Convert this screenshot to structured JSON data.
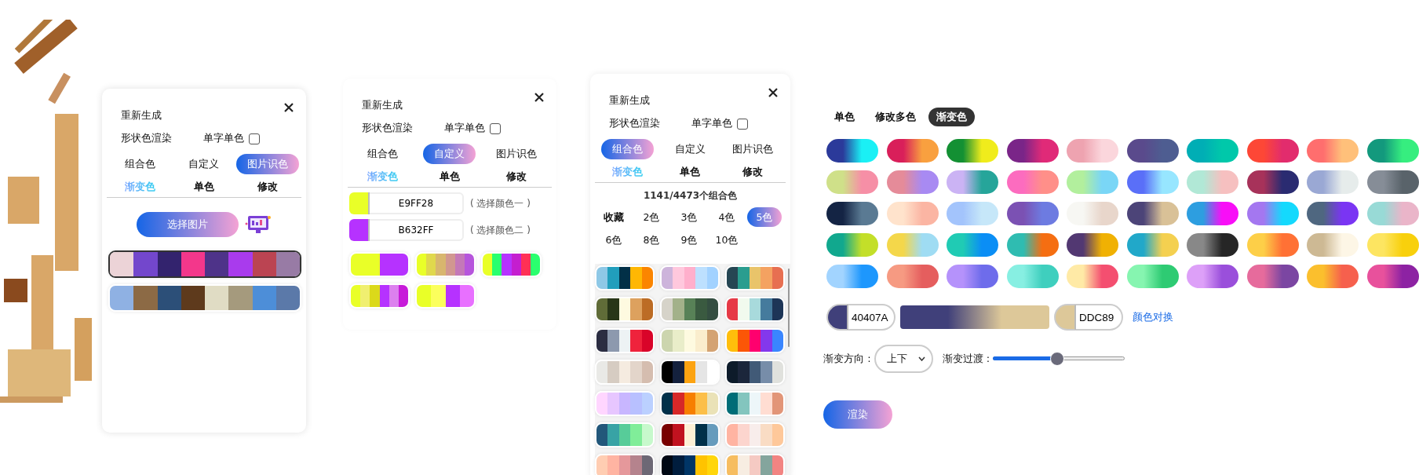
{
  "panels": [
    {
      "kind": "image",
      "title": "重新生成",
      "render_option": "形状色渲染",
      "single_color": {
        "label": "单字单色",
        "checked": false
      },
      "modes": [
        {
          "label": "组合色",
          "selected": false
        },
        {
          "label": "自定义",
          "selected": false
        },
        {
          "label": "图片识色",
          "selected": true
        }
      ],
      "sub_modes": [
        {
          "label": "渐变色",
          "accent": true
        },
        {
          "label": "单色",
          "accent": false
        },
        {
          "label": "修改",
          "accent": false
        }
      ],
      "pick_button": "选择图片",
      "palettes": [
        {
          "selected": true,
          "swatches": [
            {
              "color": "#ecd3d7"
            },
            {
              "color": "#7347cc"
            },
            {
              "color": "#33236e"
            },
            {
              "color": "#f3378b"
            },
            {
              "color": "#4e3389"
            },
            {
              "color": "#a93bed"
            },
            {
              "color": "#bb4452"
            },
            {
              "color": "#987ba5"
            }
          ]
        },
        {
          "selected": false,
          "swatches": [
            {
              "color": "#8fb1e3"
            },
            {
              "color": "#8c6a45"
            },
            {
              "color": "#2c4f78"
            },
            {
              "color": "#5e3a1c"
            },
            {
              "color": "#e0dcc4"
            },
            {
              "color": "#a59a7d"
            },
            {
              "color": "#4d8ed8"
            },
            {
              "color": "#5b79a9"
            }
          ]
        }
      ]
    },
    {
      "kind": "custom",
      "title": "重新生成",
      "render_option": "形状色渲染",
      "single_color": {
        "label": "单字单色",
        "checked": false
      },
      "modes": [
        {
          "label": "组合色",
          "selected": false
        },
        {
          "label": "自定义",
          "selected": true
        },
        {
          "label": "图片识色",
          "selected": false
        }
      ],
      "sub_modes": [
        {
          "label": "渐变色",
          "accent": true
        },
        {
          "label": "单色",
          "accent": false
        },
        {
          "label": "修改",
          "accent": false
        }
      ],
      "color_inputs": [
        {
          "value": "E9FF28",
          "color": "#e9ff28",
          "hint": "( 选择颜色一 )"
        },
        {
          "value": "B632FF",
          "color": "#b632ff",
          "hint": "( 选择颜色二 )"
        }
      ],
      "palettes": [
        {
          "selected": false,
          "swatches": [
            {
              "color": "#e9ff28"
            },
            {
              "color": "#b632ff"
            }
          ]
        },
        {
          "selected": false,
          "swatches": [
            {
              "color": "#e9ff28"
            },
            {
              "color": "#e0d84c"
            },
            {
              "color": "#d8b66e"
            },
            {
              "color": "#d19790"
            },
            {
              "color": "#c478b8"
            },
            {
              "color": "#b655dc"
            }
          ]
        },
        {
          "selected": false,
          "swatches": [
            {
              "color": "#e9ff28"
            },
            {
              "color": "#2aff6e"
            },
            {
              "color": "#b632ff"
            },
            {
              "color": "#c41ecf"
            },
            {
              "color": "#ff3055"
            },
            {
              "color": "#2aff6e"
            }
          ]
        },
        {
          "selected": false,
          "swatches": [
            {
              "color": "#e9ff28"
            },
            {
              "color": "#f0ef70"
            },
            {
              "color": "#dbd91a"
            },
            {
              "color": "#b632ff"
            },
            {
              "color": "#dc80ee"
            },
            {
              "color": "#c71ad9"
            }
          ]
        },
        {
          "selected": false,
          "swatches": [
            {
              "color": "#e9ff28"
            },
            {
              "color": "#fbff5c"
            },
            {
              "color": "#b632ff"
            },
            {
              "color": "#e870ff"
            }
          ]
        }
      ]
    },
    {
      "kind": "combo",
      "title": "重新生成",
      "render_option": "形状色渲染",
      "single_color": {
        "label": "单字单色",
        "checked": false
      },
      "modes": [
        {
          "label": "组合色",
          "selected": true
        },
        {
          "label": "自定义",
          "selected": false
        },
        {
          "label": "图片识色",
          "selected": false
        }
      ],
      "sub_modes": [
        {
          "label": "渐变色",
          "accent": true
        },
        {
          "label": "单色",
          "accent": false
        },
        {
          "label": "修改",
          "accent": false
        }
      ],
      "count": "1141/4473个组合色",
      "filters": [
        {
          "label": "收藏",
          "kind": "favorites",
          "selected": false
        },
        {
          "label": "2色",
          "kind": "count",
          "selected": false
        },
        {
          "label": "3色",
          "kind": "count",
          "selected": false
        },
        {
          "label": "4色",
          "kind": "count",
          "selected": false
        },
        {
          "label": "5色",
          "kind": "count",
          "selected": true
        },
        {
          "label": "6色",
          "kind": "count",
          "selected": false
        },
        {
          "label": "8色",
          "kind": "count",
          "selected": false
        },
        {
          "label": "9色",
          "kind": "count",
          "selected": false
        },
        {
          "label": "10色",
          "kind": "count",
          "selected": false
        }
      ],
      "palettes": [
        {
          "selected": false,
          "swatches": [
            {
              "color": "#8ec8e6"
            },
            {
              "color": "#219ebc"
            },
            {
              "color": "#023047"
            },
            {
              "color": "#ffb703"
            },
            {
              "color": "#fb8500"
            }
          ]
        },
        {
          "selected": false,
          "swatches": [
            {
              "color": "#cdb4db"
            },
            {
              "color": "#ffc8dd"
            },
            {
              "color": "#ffafcc"
            },
            {
              "color": "#bde0fe"
            },
            {
              "color": "#a2d2ff"
            }
          ]
        },
        {
          "selected": false,
          "swatches": [
            {
              "color": "#264653"
            },
            {
              "color": "#2a9d8f"
            },
            {
              "color": "#e9c46a"
            },
            {
              "color": "#f4a261"
            },
            {
              "color": "#e76f51"
            }
          ]
        },
        {
          "selected": false,
          "swatches": [
            {
              "color": "#606c38"
            },
            {
              "color": "#283618"
            },
            {
              "color": "#fefae0"
            },
            {
              "color": "#dda15e"
            },
            {
              "color": "#bc6c25"
            }
          ]
        },
        {
          "selected": false,
          "swatches": [
            {
              "color": "#d6d3c9"
            },
            {
              "color": "#a3b18a"
            },
            {
              "color": "#588157"
            },
            {
              "color": "#3a5a40"
            },
            {
              "color": "#344e41"
            }
          ]
        },
        {
          "selected": false,
          "swatches": [
            {
              "color": "#e63946"
            },
            {
              "color": "#f1faee"
            },
            {
              "color": "#a8dadc"
            },
            {
              "color": "#457b9d"
            },
            {
              "color": "#1d3557"
            }
          ]
        },
        {
          "selected": false,
          "swatches": [
            {
              "color": "#2b2d42"
            },
            {
              "color": "#8d99ae"
            },
            {
              "color": "#edf2f4"
            },
            {
              "color": "#ef233c"
            },
            {
              "color": "#d90429"
            }
          ]
        },
        {
          "selected": false,
          "swatches": [
            {
              "color": "#ccd5ae"
            },
            {
              "color": "#e9edc9"
            },
            {
              "color": "#fefae0"
            },
            {
              "color": "#faedcd"
            },
            {
              "color": "#d4a373"
            }
          ]
        },
        {
          "selected": false,
          "swatches": [
            {
              "color": "#ffbe0b"
            },
            {
              "color": "#fb5607"
            },
            {
              "color": "#ff006e"
            },
            {
              "color": "#8338ec"
            },
            {
              "color": "#3a86ff"
            }
          ]
        },
        {
          "selected": false,
          "swatches": [
            {
              "color": "#e9e9e6"
            },
            {
              "color": "#d6ccc2"
            },
            {
              "color": "#f5ebe0"
            },
            {
              "color": "#e3d5ca"
            },
            {
              "color": "#d5bdaf"
            }
          ]
        },
        {
          "selected": false,
          "swatches": [
            {
              "color": "#000000"
            },
            {
              "color": "#14213d"
            },
            {
              "color": "#fca311"
            },
            {
              "color": "#e5e5e5"
            },
            {
              "color": "#ffffff"
            }
          ]
        },
        {
          "selected": false,
          "swatches": [
            {
              "color": "#0d1b2a"
            },
            {
              "color": "#1b263b"
            },
            {
              "color": "#415a77"
            },
            {
              "color": "#778da9"
            },
            {
              "color": "#e0e1dd"
            }
          ]
        },
        {
          "selected": false,
          "swatches": [
            {
              "color": "#ffd6ff"
            },
            {
              "color": "#e7c6ff"
            },
            {
              "color": "#c8b6ff"
            },
            {
              "color": "#b8c0ff"
            },
            {
              "color": "#bbd0ff"
            }
          ]
        },
        {
          "selected": false,
          "swatches": [
            {
              "color": "#003049"
            },
            {
              "color": "#d62828"
            },
            {
              "color": "#f77f00"
            },
            {
              "color": "#fcbf49"
            },
            {
              "color": "#eae2b7"
            }
          ]
        },
        {
          "selected": false,
          "swatches": [
            {
              "color": "#006d77"
            },
            {
              "color": "#83c5be"
            },
            {
              "color": "#edf6f9"
            },
            {
              "color": "#ffddd2"
            },
            {
              "color": "#e29578"
            }
          ]
        },
        {
          "selected": false,
          "swatches": [
            {
              "color": "#22577a"
            },
            {
              "color": "#38a3a5"
            },
            {
              "color": "#57cc99"
            },
            {
              "color": "#80ed99"
            },
            {
              "color": "#c7f9cc"
            }
          ]
        },
        {
          "selected": false,
          "swatches": [
            {
              "color": "#780000"
            },
            {
              "color": "#c1121f"
            },
            {
              "color": "#fdf0d5"
            },
            {
              "color": "#003049"
            },
            {
              "color": "#669bbc"
            }
          ]
        },
        {
          "selected": false,
          "swatches": [
            {
              "color": "#ffb4a2"
            },
            {
              "color": "#fcd5ce"
            },
            {
              "color": "#f8edeb"
            },
            {
              "color": "#f9dcc4"
            },
            {
              "color": "#fec89a"
            }
          ]
        },
        {
          "selected": false,
          "swatches": [
            {
              "color": "#ffcdb2"
            },
            {
              "color": "#ffb4a2"
            },
            {
              "color": "#e5989b"
            },
            {
              "color": "#b5838d"
            },
            {
              "color": "#6d6875"
            }
          ]
        },
        {
          "selected": false,
          "swatches": [
            {
              "color": "#000814"
            },
            {
              "color": "#001d3d"
            },
            {
              "color": "#003566"
            },
            {
              "color": "#ffc300"
            },
            {
              "color": "#ffd60a"
            }
          ]
        },
        {
          "selected": false,
          "swatches": [
            {
              "color": "#f6bd60"
            },
            {
              "color": "#f7ede2"
            },
            {
              "color": "#f5cac3"
            },
            {
              "color": "#84a59d"
            },
            {
              "color": "#f28482"
            }
          ]
        }
      ]
    }
  ],
  "gradient_editor": {
    "tabs": [
      {
        "label": "单色",
        "selected": false
      },
      {
        "label": "修改多色",
        "selected": false
      },
      {
        "label": "渐变色",
        "selected": true
      }
    ],
    "presets": [
      {
        "stops": [
          {
            "color": "#2b3a9a"
          },
          {
            "color": "#1af0f5"
          }
        ]
      },
      {
        "stops": [
          {
            "color": "#d91f5a"
          },
          {
            "color": "#f9a03f"
          }
        ]
      },
      {
        "stops": [
          {
            "color": "#139033"
          },
          {
            "color": "#f0ec1c"
          }
        ]
      },
      {
        "stops": [
          {
            "color": "#7a2588"
          },
          {
            "color": "#e02a78"
          }
        ]
      },
      {
        "stops": [
          {
            "color": "#eea3b0"
          },
          {
            "color": "#fbd6dc"
          }
        ]
      },
      {
        "stops": [
          {
            "color": "#5a4a8c"
          },
          {
            "color": "#4e5d91"
          }
        ]
      },
      {
        "stops": [
          {
            "color": "#00aeb5"
          },
          {
            "color": "#00c8aa"
          }
        ]
      },
      {
        "stops": [
          {
            "color": "#fd4736"
          },
          {
            "color": "#e22c6d"
          }
        ]
      },
      {
        "stops": [
          {
            "color": "#ff6e6e"
          },
          {
            "color": "#ffc07a"
          }
        ]
      },
      {
        "stops": [
          {
            "color": "#13997d"
          },
          {
            "color": "#36ee7f"
          }
        ]
      },
      {
        "stops": [
          {
            "color": "#cfe089"
          },
          {
            "color": "#f68fa6"
          }
        ]
      },
      {
        "stops": [
          {
            "color": "#e58b99"
          },
          {
            "color": "#a88af2"
          }
        ]
      },
      {
        "stops": [
          {
            "color": "#cbb3f4"
          },
          {
            "color": "#26a59a"
          }
        ]
      },
      {
        "stops": [
          {
            "color": "#fc6cbf"
          },
          {
            "color": "#ff8f89"
          }
        ]
      },
      {
        "stops": [
          {
            "color": "#b2ef9d"
          },
          {
            "color": "#7ad6f6"
          }
        ]
      },
      {
        "stops": [
          {
            "color": "#5a6ff8"
          },
          {
            "color": "#97e6ff"
          }
        ]
      },
      {
        "stops": [
          {
            "color": "#b1e8d6"
          },
          {
            "color": "#f6c0c0"
          }
        ]
      },
      {
        "stops": [
          {
            "color": "#a7325a"
          },
          {
            "color": "#2a2b71"
          }
        ]
      },
      {
        "stops": [
          {
            "color": "#9aa8d4"
          },
          {
            "color": "#e6eceb"
          }
        ]
      },
      {
        "stops": [
          {
            "color": "#868d97"
          },
          {
            "color": "#59636a"
          }
        ]
      },
      {
        "stops": [
          {
            "color": "#142444"
          },
          {
            "color": "#5a7a93"
          }
        ]
      },
      {
        "stops": [
          {
            "color": "#ffe3cc"
          },
          {
            "color": "#fbb5a3"
          }
        ]
      },
      {
        "stops": [
          {
            "color": "#a3c4fc"
          },
          {
            "color": "#c6e7f9"
          }
        ]
      },
      {
        "stops": [
          {
            "color": "#7b51b3"
          },
          {
            "color": "#6d7be1"
          }
        ]
      },
      {
        "stops": [
          {
            "color": "#f7f7f3"
          },
          {
            "color": "#e8d6cb"
          }
        ]
      },
      {
        "stops": [
          {
            "color": "#4c4478"
          },
          {
            "color": "#d9c197"
          }
        ]
      },
      {
        "stops": [
          {
            "color": "#2d9ee0"
          },
          {
            "color": "#f80ef7"
          }
        ]
      },
      {
        "stops": [
          {
            "color": "#a477f0"
          },
          {
            "color": "#14d9fd"
          }
        ]
      },
      {
        "stops": [
          {
            "color": "#4f6780"
          },
          {
            "color": "#7a35f3"
          }
        ]
      },
      {
        "stops": [
          {
            "color": "#98dad6"
          },
          {
            "color": "#eab5c9"
          }
        ]
      },
      {
        "stops": [
          {
            "color": "#11a88e"
          },
          {
            "color": "#c3df29"
          }
        ]
      },
      {
        "stops": [
          {
            "color": "#f4d74a"
          },
          {
            "color": "#9fdcf3"
          }
        ]
      },
      {
        "stops": [
          {
            "color": "#20cbb4"
          },
          {
            "color": "#0a8ef5"
          }
        ]
      },
      {
        "stops": [
          {
            "color": "#2fbcb1"
          },
          {
            "color": "#f56e12"
          }
        ]
      },
      {
        "stops": [
          {
            "color": "#523872"
          },
          {
            "color": "#f0b103"
          }
        ]
      },
      {
        "stops": [
          {
            "color": "#21a8c9"
          },
          {
            "color": "#f4d050"
          }
        ]
      },
      {
        "stops": [
          {
            "color": "#888888"
          },
          {
            "color": "#262626"
          }
        ]
      },
      {
        "stops": [
          {
            "color": "#fdcf48"
          },
          {
            "color": "#ff7135"
          }
        ]
      },
      {
        "stops": [
          {
            "color": "#cdb994"
          },
          {
            "color": "#fdf6e6"
          }
        ]
      },
      {
        "stops": [
          {
            "color": "#fde561"
          },
          {
            "color": "#f8d00c"
          }
        ]
      },
      {
        "stops": [
          {
            "color": "#a2d4ff"
          },
          {
            "color": "#1d97fd"
          }
        ]
      },
      {
        "stops": [
          {
            "color": "#f69a82"
          },
          {
            "color": "#e55e5e"
          }
        ]
      },
      {
        "stops": [
          {
            "color": "#b592fb"
          },
          {
            "color": "#6e6ceb"
          }
        ]
      },
      {
        "stops": [
          {
            "color": "#87efe2"
          },
          {
            "color": "#3fcfbe"
          }
        ]
      },
      {
        "stops": [
          {
            "color": "#ffeaa6"
          },
          {
            "color": "#f44f70"
          }
        ]
      },
      {
        "stops": [
          {
            "color": "#86f5b0"
          },
          {
            "color": "#2ecb73"
          }
        ]
      },
      {
        "stops": [
          {
            "color": "#dda0f8"
          },
          {
            "color": "#9a4fdb"
          }
        ]
      },
      {
        "stops": [
          {
            "color": "#e66b9c"
          },
          {
            "color": "#7b46a2"
          }
        ]
      },
      {
        "stops": [
          {
            "color": "#fbbf2d"
          },
          {
            "color": "#f6604d"
          }
        ]
      },
      {
        "stops": [
          {
            "color": "#e8519c"
          },
          {
            "color": "#8d22a3"
          }
        ]
      }
    ],
    "start": {
      "value": "40407A",
      "color": "#40407a"
    },
    "end": {
      "value": "DDC89",
      "color": "#ddc899"
    },
    "swap_link": "颜色对换",
    "direction": {
      "label": "渐变方向 :",
      "value": "上下"
    },
    "transition": {
      "label": "渐变过渡 :",
      "level": 0.49
    },
    "render_button": "渲染"
  }
}
